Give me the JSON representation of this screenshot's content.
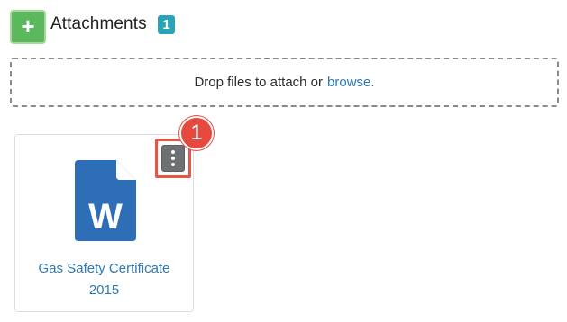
{
  "header": {
    "add_icon": "plus-icon",
    "add_symbol": "+",
    "title": "Attachments",
    "count": "1"
  },
  "dropzone": {
    "text": "Drop files to attach or",
    "browse_label": "browse."
  },
  "attachments": [
    {
      "icon": "word-document-icon",
      "icon_letter": "W",
      "name_line1": "Gas Safety Certificate",
      "name_line2": "2015",
      "menu_icon": "kebab-menu-icon"
    }
  ],
  "annotation": {
    "step": "1",
    "color": "#e64a3f"
  },
  "colors": {
    "add_button": "#5cb85c",
    "badge": "#2aa3b8",
    "link": "#2a7ab8",
    "word_icon": "#2d6eb6"
  }
}
